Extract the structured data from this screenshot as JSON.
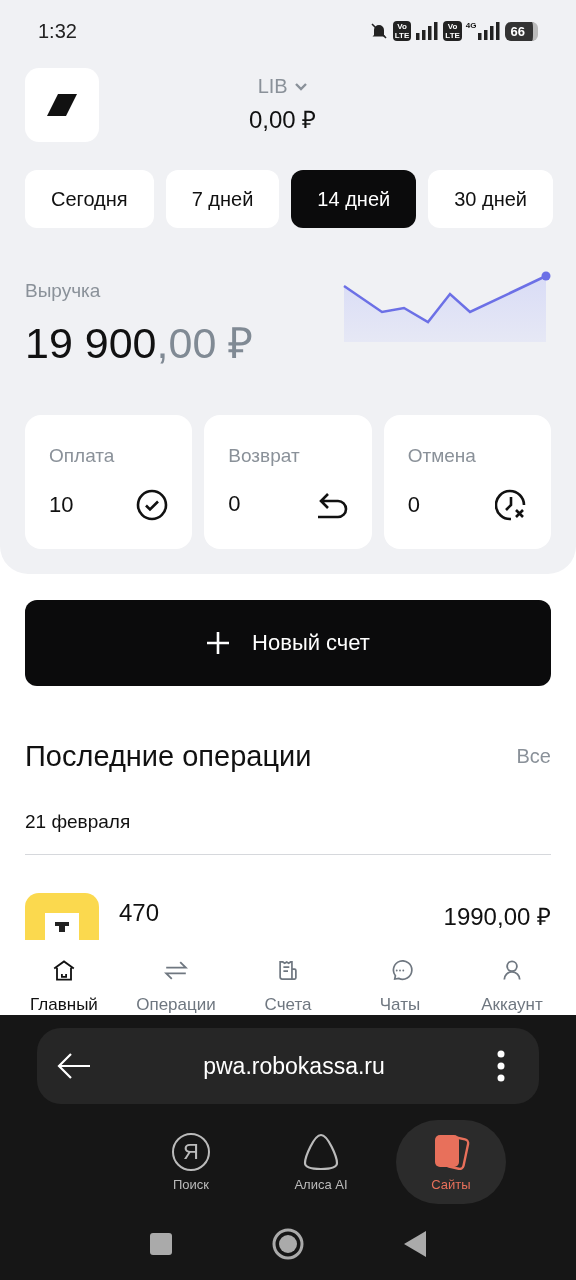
{
  "status_bar": {
    "time": "1:32",
    "sim_badges": [
      {
        "top": "Vo",
        "bottom": "LTE"
      },
      {
        "top": "Vo",
        "bottom": "LTE",
        "network": "4G"
      }
    ],
    "battery": "66"
  },
  "header": {
    "account": "LIB",
    "balance": "0,00 ₽"
  },
  "periods": [
    {
      "label": "Сегодня",
      "selected": false
    },
    {
      "label": "7 дней",
      "selected": false
    },
    {
      "label": "14 дней",
      "selected": true
    },
    {
      "label": "30 дней",
      "selected": false
    }
  ],
  "revenue": {
    "label": "Выручка",
    "whole": "19 900",
    "fraction": ",00 ₽"
  },
  "stats": [
    {
      "kind": "paid",
      "label": "Оплата",
      "value": "10"
    },
    {
      "kind": "refund",
      "label": "Возврат",
      "value": "0"
    },
    {
      "kind": "cancel",
      "label": "Отмена",
      "value": "0"
    }
  ],
  "new_invoice_button": "Новый счет",
  "recent": {
    "title": "Последние операции",
    "all_link": "Все",
    "date": "21 февраля",
    "operations": [
      {
        "name": "470",
        "amount": "1990,00 ₽"
      }
    ]
  },
  "bottom_nav": [
    {
      "kind": "home",
      "label": "Главный",
      "selected": true
    },
    {
      "kind": "operations",
      "label": "Операции",
      "selected": false
    },
    {
      "kind": "invoices",
      "label": "Счета",
      "selected": false
    },
    {
      "kind": "chats",
      "label": "Чаты",
      "selected": false
    },
    {
      "kind": "account",
      "label": "Аккаунт",
      "selected": false
    }
  ],
  "browser": {
    "url": "pwa.robokassa.ru",
    "tabs": [
      {
        "kind": "search",
        "label": "Поиск",
        "icon_letter": "Я",
        "selected": false
      },
      {
        "kind": "alice",
        "label": "Алиса AI",
        "selected": false
      },
      {
        "kind": "sites",
        "label": "Сайты",
        "selected": true
      }
    ]
  }
}
